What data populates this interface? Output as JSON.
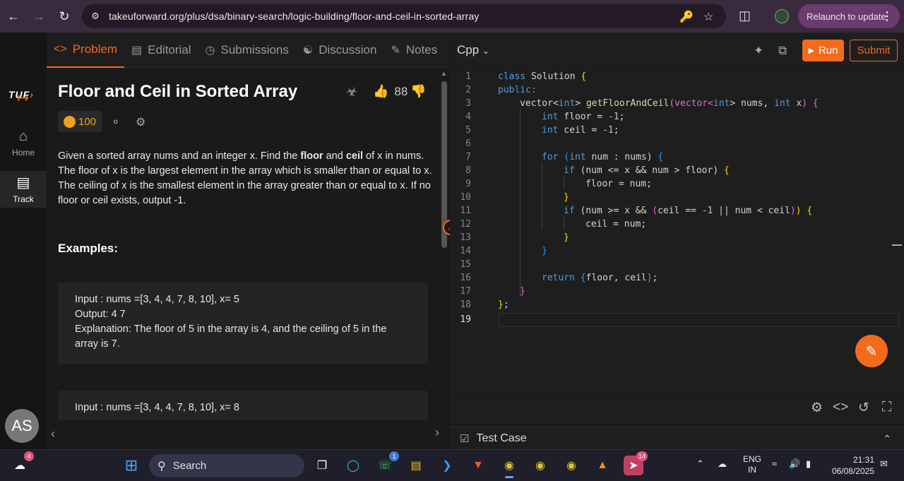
{
  "browser": {
    "url": "takeuforward.org/plus/dsa/binary-search/logic-building/floor-and-ceil-in-sorted-array",
    "relaunch_label": "Relaunch to update"
  },
  "sidebar": {
    "logo_text": "TUF",
    "items": [
      {
        "label": "Home"
      },
      {
        "label": "Track"
      }
    ],
    "avatar_initials": "AS"
  },
  "problem_tabs": [
    {
      "label": "Problem"
    },
    {
      "label": "Editorial"
    },
    {
      "label": "Submissions"
    },
    {
      "label": "Discussion"
    },
    {
      "label": "Notes"
    }
  ],
  "problem": {
    "title": "Floor and Ceil in Sorted Array",
    "likes": "88",
    "coins": "100",
    "desc_1": "Given a sorted array nums and an integer x. Find the ",
    "desc_floor": "floor",
    "desc_and": " and ",
    "desc_ceil": "ceil",
    "desc_2": " of x in nums. The floor of x is the largest element in the array which is smaller than or equal to x. The ceiling of x is the smallest element in the array greater than or equal to x. If no floor or ceil exists, output -1.",
    "examples_heading": "Examples:",
    "example1": {
      "input": "Input : nums =[3, 4, 4, 7, 8, 10], x= 5",
      "output": "Output: 4 7",
      "explanation": "Explanation: The floor of 5 in the array is 4, and the ceiling of 5 in the array is 7."
    },
    "example2": {
      "input": "Input : nums =[3, 4, 4, 7, 8, 10], x= 8"
    }
  },
  "editor": {
    "language": "Cpp",
    "run_label": "Run",
    "submit_label": "Submit",
    "line_numbers": [
      "1",
      "2",
      "3",
      "4",
      "5",
      "6",
      "7",
      "8",
      "9",
      "10",
      "11",
      "12",
      "13",
      "14",
      "15",
      "16",
      "17",
      "18",
      "19"
    ],
    "code": {
      "l1_kw": "class",
      "l1_name": " Solution ",
      "l1_brace": "{",
      "l2": "public:",
      "l3_a": "vector<",
      "l3_int": "int",
      "l3_b": "> ",
      "l3_fn": "getFloorAndCeil",
      "l3_c": "(vector<",
      "l3_int2": "int",
      "l3_d": "> ",
      "l3_nums": "nums",
      "l3_e": ", ",
      "l3_int3": "int",
      "l3_x": " x",
      "l3_f": ") ",
      "l3_brace": "{",
      "l4_int": "int",
      "l4_rest": " floor = ",
      "l4_num": "-1",
      "l4_end": ";",
      "l5_int": "int",
      "l5_rest": " ceil = ",
      "l5_num": "-1",
      "l5_end": ";",
      "l7_for": "for",
      "l7_a": " (",
      "l7_int": "int",
      "l7_b": " num : nums) ",
      "l7_brace": "{",
      "l8_if": "if",
      "l8_a": " (num <= x && num > floor) ",
      "l8_brace": "{",
      "l9": "floor = num;",
      "l10": "}",
      "l11_if": "if",
      "l11_a": " (num >= x && ",
      "l11_p": "(",
      "l11_b": "ceil == ",
      "l11_num": "-1",
      "l11_c": " || num < ceil",
      "l11_p2": ")",
      "l11_d": ") ",
      "l11_brace": "{",
      "l12": "ceil = num;",
      "l13": "}",
      "l14": "}",
      "l16_ret": "return",
      "l16_a": " ",
      "l16_b": "{",
      "l16_c": "floor, ceil",
      "l16_d": "}",
      "l16_e": ";",
      "l17": "}",
      "l18_a": "}",
      "l18_b": ";"
    }
  },
  "testcase": {
    "label": "Test Case"
  },
  "taskbar": {
    "search_label": "Search",
    "notif_badge": "4",
    "whatsapp_badge": "1",
    "telegram_badge": "14",
    "lang": "ENG",
    "region": "IN",
    "time": "21:31",
    "date": "06/08/2025"
  },
  "colors": {
    "accent": "#f36a1d"
  }
}
